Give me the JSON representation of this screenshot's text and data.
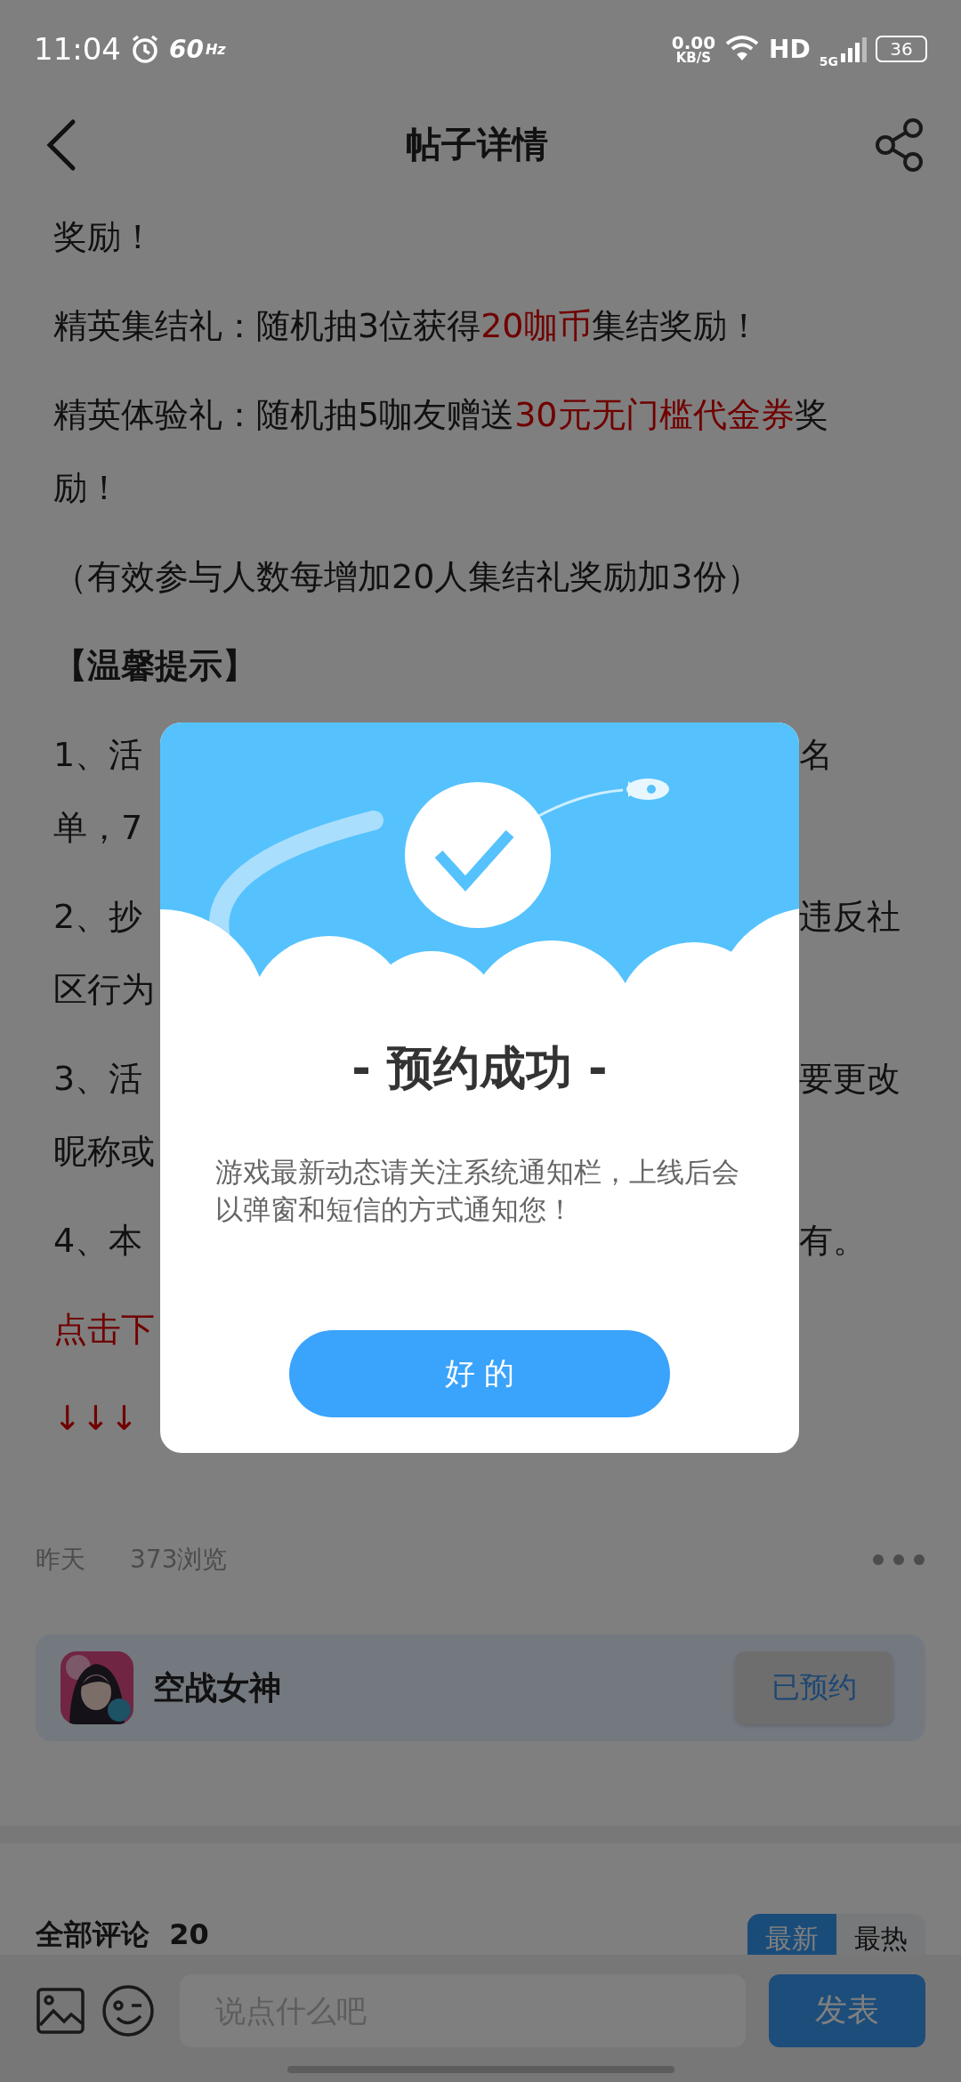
{
  "status_bar": {
    "time": "11:04",
    "refresh_rate": "60",
    "refresh_unit": "Hz",
    "net_speed": "0.00",
    "net_unit": "KB/S",
    "hd": "HD",
    "network": "5G",
    "battery": "36"
  },
  "header": {
    "title": "帖子详情"
  },
  "article": [
    {
      "kind": "text",
      "lines": [
        {
          "segments": [
            {
              "text": "奖励！",
              "red": false
            }
          ]
        }
      ]
    },
    {
      "kind": "text",
      "lines": [
        {
          "segments": [
            {
              "text": "精英集结礼：随机抽3位获得",
              "red": false
            },
            {
              "text": "20咖币",
              "red": true
            },
            {
              "text": "集结奖励！",
              "red": false
            }
          ]
        }
      ]
    },
    {
      "kind": "text",
      "lines": [
        {
          "segments": [
            {
              "text": "精英体验礼：随机抽5咖友赠送",
              "red": false
            },
            {
              "text": "30元无门槛代金券",
              "red": true
            },
            {
              "text": "奖",
              "red": false
            }
          ]
        },
        {
          "segments": [
            {
              "text": "励！",
              "red": false
            }
          ]
        }
      ]
    },
    {
      "kind": "text",
      "lines": [
        {
          "segments": [
            {
              "text": "（有效参与人数每增加20人集结礼奖励加3份）",
              "red": false
            }
          ]
        }
      ]
    },
    {
      "kind": "heading",
      "lines": [
        {
          "segments": [
            {
              "text": "【温馨提示】",
              "red": false
            }
          ]
        }
      ]
    },
    {
      "kind": "text",
      "lines": [
        {
          "segments": [
            {
              "text": "1、活",
              "red": false
            }
          ],
          "right": "名"
        },
        {
          "segments": [
            {
              "text": "单，7",
              "red": false
            }
          ]
        }
      ]
    },
    {
      "kind": "text",
      "lines": [
        {
          "segments": [
            {
              "text": "2、抄",
              "red": false
            }
          ],
          "right": "违反社"
        },
        {
          "segments": [
            {
              "text": "区行为",
              "red": false
            }
          ]
        }
      ]
    },
    {
      "kind": "text",
      "lines": [
        {
          "segments": [
            {
              "text": "3、活",
              "red": false
            }
          ],
          "right": "要更改"
        },
        {
          "segments": [
            {
              "text": "昵称或",
              "red": false
            }
          ]
        }
      ]
    },
    {
      "kind": "text",
      "lines": [
        {
          "segments": [
            {
              "text": "4、本",
              "red": false
            }
          ],
          "right": "有。"
        }
      ]
    },
    {
      "kind": "text",
      "lines": [
        {
          "segments": [
            {
              "text": "点击下",
              "red": true
            }
          ]
        }
      ]
    },
    {
      "kind": "text",
      "lines": [
        {
          "segments": [
            {
              "text": "↓↓↓",
              "red": true
            }
          ]
        }
      ]
    }
  ],
  "meta": {
    "date": "昨天",
    "views": "373浏览"
  },
  "game_card": {
    "name": "空战女神",
    "button": "已预约"
  },
  "comments": {
    "title": "全部评论",
    "count": "20",
    "tabs": [
      {
        "label": "最新",
        "selected": true
      },
      {
        "label": "最热",
        "selected": false
      }
    ]
  },
  "composer": {
    "placeholder": "说点什么吧",
    "send": "发表"
  },
  "dialog": {
    "title": "- 预约成功 -",
    "message": "游戏最新动态请关注系统通知栏，上线后会以弹窗和短信的方式通知您！",
    "button": "好 的"
  }
}
